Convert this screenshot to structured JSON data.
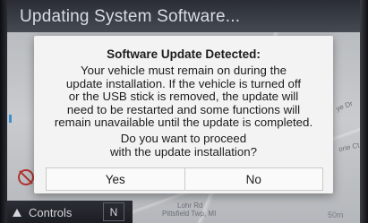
{
  "header": {
    "title": "Updating System Software..."
  },
  "map": {
    "streets": [
      "ye Dr",
      "orie Ct",
      "Lohr Rd",
      "Pittsfield Twp, MI"
    ],
    "distance": "50m"
  },
  "bottom_bar": {
    "controls_label": "Controls",
    "gear": "N"
  },
  "dialog": {
    "heading": "Software Update Detected:",
    "body_lines": [
      "Your vehicle must remain on during the",
      "update installation. If the vehicle is turned off",
      "or the USB stick is removed, the update will",
      "need to be restarted and some functions will",
      "remain unavailable until the update is completed."
    ],
    "question_lines": [
      "Do you want to proceed",
      "with the update installation?"
    ],
    "buttons": {
      "yes": "Yes",
      "no": "No"
    }
  },
  "colors": {
    "title_bar": "#2a2d35",
    "dialog_bg": "#f3f3f3",
    "accent": "#3b8fd3",
    "no_icon": "#b0332d"
  },
  "icons": [
    "no-entry-icon",
    "triangle-up-icon"
  ]
}
